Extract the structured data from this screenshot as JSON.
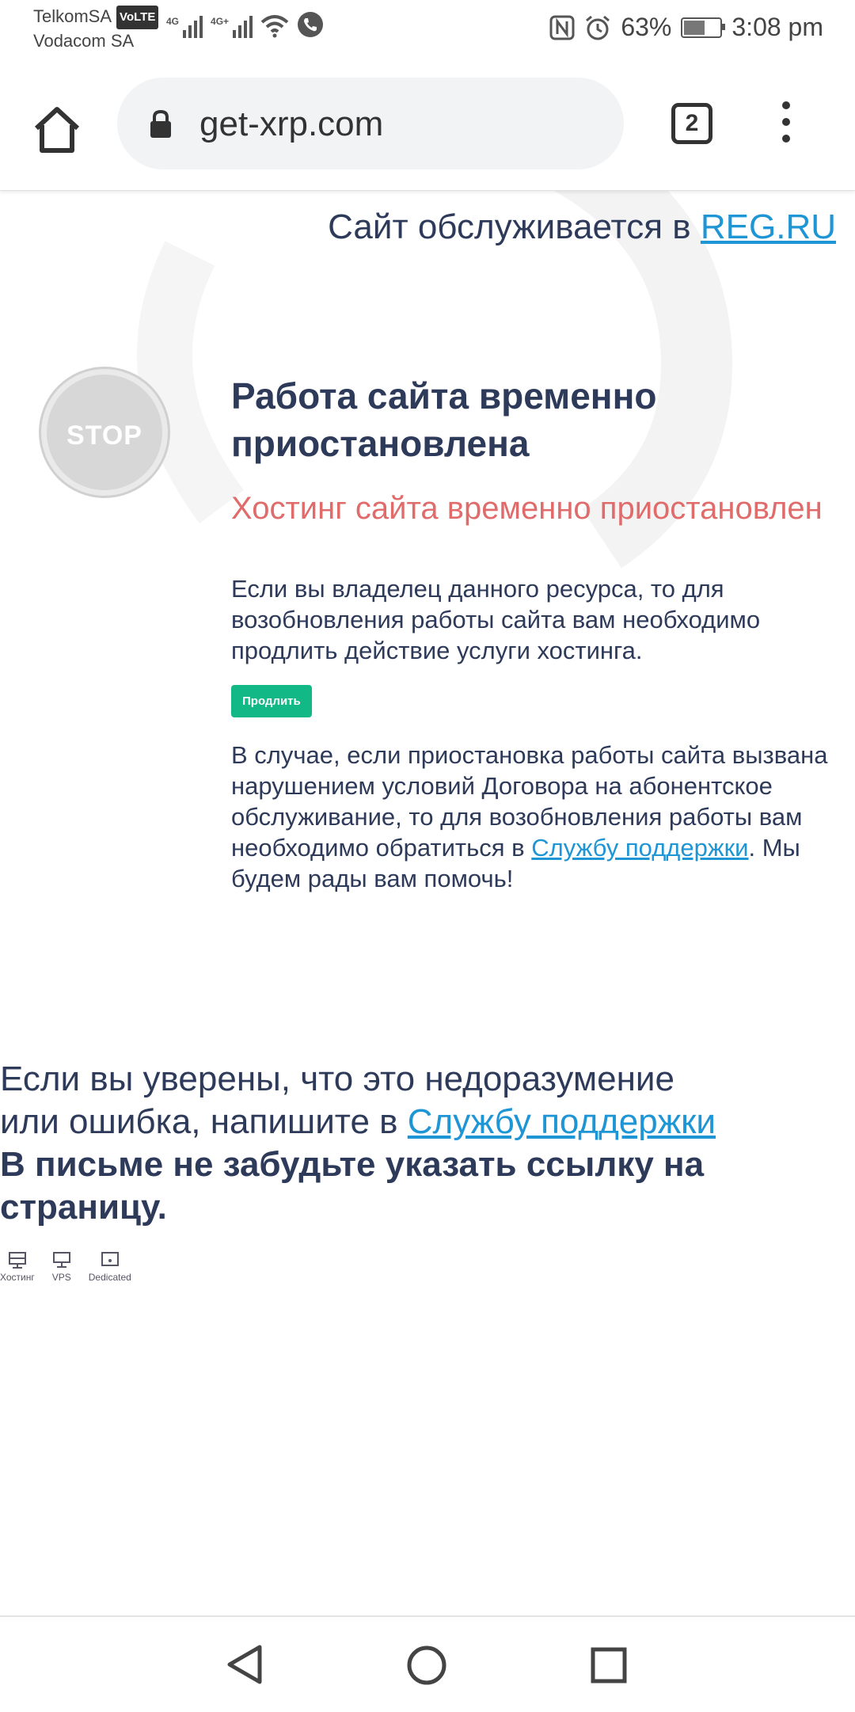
{
  "status_bar": {
    "carrier1": "TelkomSA",
    "volte": "VoLTE",
    "carrier2": "Vodacom SA",
    "net1": "4G",
    "net2": "4G+",
    "battery": "63%",
    "battery_level": 0.63,
    "time": "3:08 pm"
  },
  "browser": {
    "url": "get-xrp.com",
    "tab_count": "2"
  },
  "page": {
    "hosted_prefix": "Сайт обслуживается в",
    "hosted_link": "REG.RU",
    "stop_label": "STOP",
    "title": "Работа сайта временно приостановлена",
    "subtitle": "Хостинг сайта временно приостановлен",
    "para1": "Если вы владелец данного ресурса, то для возобновления работы сайта вам необходимо продлить действие услуги хостинга.",
    "renew_button": "Продлить",
    "para2_before": "В случае, если приостановка работы сайта вызвана нарушением условий Договора на абонентское обслуживание, то для возобновления работы вам необходимо обратиться в",
    "para2_link": "Службу поддержки",
    "para2_after": ". Мы будем рады вам помочь!",
    "note_line1": "Если вы уверены, что это недоразумение",
    "note_line2_before": "или ошибка, напишите в",
    "note_link": "Службу поддержки",
    "note_bold": "В письме не забудьте указать ссылку на страницу.",
    "services": [
      "Хостинг",
      "VPS",
      "Dedicated"
    ]
  },
  "colors": {
    "text": "#2e3a59",
    "link": "#1e95d4",
    "accent_red": "#e06b6b",
    "button_green": "#12b886"
  }
}
